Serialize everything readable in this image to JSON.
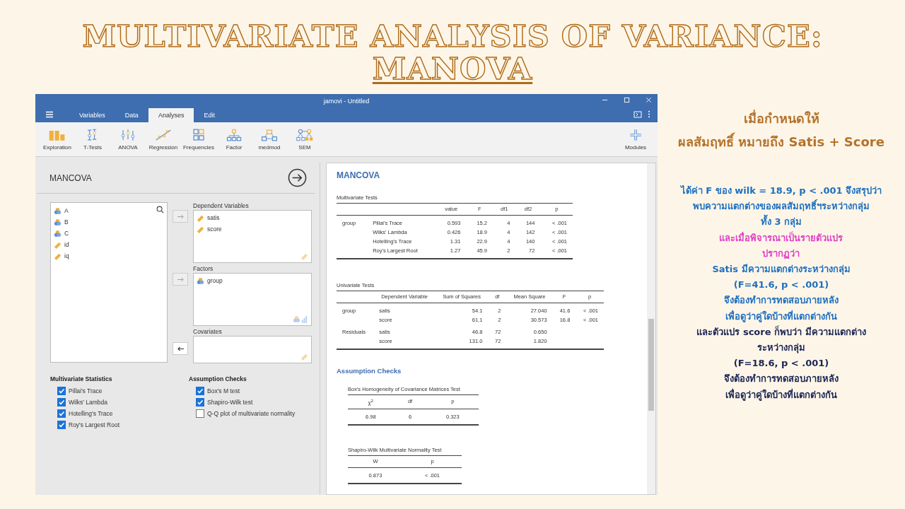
{
  "slide_title": {
    "line1": "MULTIVARIATE ANALYSIS OF VARIANCE:",
    "line2": "MANOVA"
  },
  "window": {
    "title": "jamovi - Untitled",
    "tabs": [
      {
        "label": "Variables",
        "selected": false
      },
      {
        "label": "Data",
        "selected": false
      },
      {
        "label": "Analyses",
        "selected": true
      },
      {
        "label": "Edit",
        "selected": false
      }
    ],
    "toolbar": [
      {
        "label": "Exploration",
        "kind": "bars"
      },
      {
        "label": "T-Tests",
        "kind": "ttest"
      },
      {
        "label": "ANOVA",
        "kind": "anova"
      },
      {
        "label": "Regression",
        "kind": "regression"
      },
      {
        "label": "Frequencies",
        "kind": "grid"
      },
      {
        "label": "Factor",
        "kind": "tree"
      },
      {
        "label": "medmod",
        "kind": "medmod"
      },
      {
        "label": "SEM",
        "kind": "sem"
      }
    ],
    "modules": {
      "label": "Modules"
    }
  },
  "analysis_panel": {
    "title": "MANCOVA",
    "variables": [
      {
        "name": "A",
        "kind": "nominal"
      },
      {
        "name": "B",
        "kind": "nominal"
      },
      {
        "name": "C",
        "kind": "nominal"
      },
      {
        "name": "id",
        "kind": "continuous"
      },
      {
        "name": "iq",
        "kind": "continuous"
      }
    ],
    "targets": [
      {
        "label": "Dependent Variables",
        "kind": "dependent",
        "items": [
          {
            "name": "satis",
            "kind": "continuous"
          },
          {
            "name": "score",
            "kind": "continuous"
          }
        ]
      },
      {
        "label": "Factors",
        "kind": "factor",
        "items": [
          {
            "name": "group",
            "kind": "nominal"
          }
        ]
      },
      {
        "label": "Covariates",
        "kind": "covariate"
      }
    ],
    "option_groups": [
      {
        "heading": "Multivariate Statistics",
        "options": [
          {
            "label": "Pillai's Trace",
            "checked": true
          },
          {
            "label": "Wilks' Lambda",
            "checked": true
          },
          {
            "label": "Hotelling's Trace",
            "checked": true
          },
          {
            "label": "Roy's Largest Root",
            "checked": true
          }
        ]
      },
      {
        "heading": "Assumption Checks",
        "options": [
          {
            "label": "Box's M test",
            "checked": true
          },
          {
            "label": "Shapiro-Wilk test",
            "checked": true
          },
          {
            "label": "Q-Q plot of multivariate normality",
            "checked": false
          }
        ]
      }
    ]
  },
  "results": {
    "title": "MANCOVA",
    "multivariate": {
      "title": "Multivariate Tests",
      "columns": [
        "value",
        "F",
        "df1",
        "df2",
        "p"
      ],
      "rows": [
        {
          "group": "group",
          "name": "Pillai's Trace",
          "values": [
            "0.593",
            "15.2",
            "4",
            "144",
            "< .001"
          ]
        },
        {
          "name": "Wilks' Lambda",
          "values": [
            "0.426",
            "18.9",
            "4",
            "142",
            "< .001"
          ]
        },
        {
          "name": "Hotelling's Trace",
          "values": [
            "1.31",
            "22.9",
            "4",
            "140",
            "< .001"
          ]
        },
        {
          "name": "Roy's Largest Root",
          "values": [
            "1.27",
            "45.9",
            "2",
            "72",
            "< .001"
          ]
        }
      ]
    },
    "univariate": {
      "title": "Univariate Tests",
      "columns": [
        "Dependent Variable",
        "Sum of Squares",
        "df",
        "Mean Square",
        "F",
        "p"
      ],
      "rows": [
        {
          "group": "group",
          "values": [
            "satis",
            "54.1",
            "2",
            "27.040",
            "41.6",
            "< .001"
          ]
        },
        {
          "values": [
            "score",
            "61.1",
            "2",
            "30.573",
            "16.8",
            "< .001"
          ]
        },
        {
          "group": "Residuals",
          "values": [
            "satis",
            "46.8",
            "72",
            "0.650"
          ]
        },
        {
          "values": [
            "score",
            "131.0",
            "72",
            "1.820"
          ]
        }
      ]
    },
    "assumption_title": "Assumption Checks",
    "box_test": {
      "title": "Box's Homogeneity of Covariance Matrices Test",
      "columns": [
        "χ$^{2}$",
        "df",
        "p"
      ],
      "rows": [
        [
          "6.98",
          "6",
          "0.323"
        ]
      ]
    },
    "shapiro_test": {
      "title": "Shapiro-Wilk Multivariate Normality Test",
      "columns": [
        "W",
        "p"
      ],
      "rows": [
        [
          "0.873",
          "< .001"
        ]
      ]
    }
  },
  "notes": {
    "heading": [
      "เมื่อกำหนดให้",
      "ผลสัมฤทธิ์ หมายถึง Satis + Score"
    ],
    "lines": [
      {
        "text": "ได้ค่า F ของ wilk = 18.9, p < .001 จึงสรุปว่า",
        "color": "#1f6fbf"
      },
      {
        "text": "พบความแตกต่างของผลสัมฤทธิ์ฯระหว่างกลุ่ม",
        "color": "#1f6fbf"
      },
      {
        "text": "ทั้ง 3 กลุ่ม",
        "color": "#1f6fbf"
      },
      {
        "text": "และเมื่อพิจารณาเป็นรายตัวแปร",
        "color": "#e03fc4"
      },
      {
        "text": "ปรากฏว่า",
        "color": "#e03fc4"
      },
      {
        "text": "Satis มีความแตกต่างระหว่างกลุ่ม",
        "color": "#1f6fbf"
      },
      {
        "text": "(F=41.6, p < .001)",
        "color": "#1f6fbf"
      },
      {
        "text": "จึงต้องทำการทดสอบภายหลัง",
        "color": "#1f6fbf"
      },
      {
        "text": "เพื่อดูว่าคู่ใดบ้างที่แตกต่างกัน",
        "color": "#1f6fbf"
      },
      {
        "text": "และตัวแปร score ก็พบว่า มีความแตกต่าง",
        "color": "#1b2452"
      },
      {
        "text": "ระหว่างกลุ่ม",
        "color": "#1b2452"
      },
      {
        "text": "(F=18.6, p < .001)",
        "color": "#1b2452"
      },
      {
        "text": "จึงต้องทำการทดสอบภายหลัง",
        "color": "#1b2452"
      },
      {
        "text": "เพื่อดูว่าคู่ใดบ้างที่แตกต่างกัน",
        "color": "#1b2452"
      }
    ]
  }
}
